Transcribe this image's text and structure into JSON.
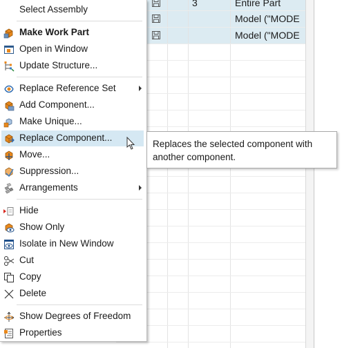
{
  "menu": {
    "items": [
      {
        "label": "Select Assembly",
        "icon": "none"
      },
      {
        "label": "Make Work Part",
        "icon": "make-work-part-icon",
        "bold": true
      },
      {
        "label": "Open in Window",
        "icon": "window-icon"
      },
      {
        "label": "Update Structure...",
        "icon": "update-structure-icon"
      },
      {
        "label": "Replace Reference Set",
        "icon": "reference-set-icon",
        "submenu": true
      },
      {
        "label": "Add Component...",
        "icon": "add-component-icon"
      },
      {
        "label": "Make Unique...",
        "icon": "make-unique-icon"
      },
      {
        "label": "Replace Component...",
        "icon": "replace-component-icon",
        "highlighted": true
      },
      {
        "label": "Move...",
        "icon": "move-icon"
      },
      {
        "label": "Suppression...",
        "icon": "suppression-icon"
      },
      {
        "label": "Arrangements",
        "icon": "arrangements-icon",
        "submenu": true
      },
      {
        "label": "Hide",
        "icon": "hide-icon"
      },
      {
        "label": "Show Only",
        "icon": "show-only-icon"
      },
      {
        "label": "Isolate in New Window",
        "icon": "isolate-icon"
      },
      {
        "label": "Cut",
        "icon": "scissors-icon"
      },
      {
        "label": "Copy",
        "icon": "copy-icon"
      },
      {
        "label": "Delete",
        "icon": "delete-x-icon"
      },
      {
        "label": "Show Degrees of Freedom",
        "icon": "degrees-of-freedom-icon"
      },
      {
        "label": "Properties",
        "icon": "properties-icon"
      }
    ]
  },
  "tooltip": {
    "text": "Replaces the selected component with another component."
  },
  "grid": {
    "rows": [
      {
        "count": "3",
        "reference": "Entire Part"
      },
      {
        "count": "",
        "reference": "Model (\"MODE"
      },
      {
        "count": "",
        "reference": "Model (\"MODE"
      }
    ]
  },
  "colors": {
    "highlight": "#d5e8f3",
    "row_selected": "#dcebf2",
    "icon_orange": "#e8881c"
  }
}
